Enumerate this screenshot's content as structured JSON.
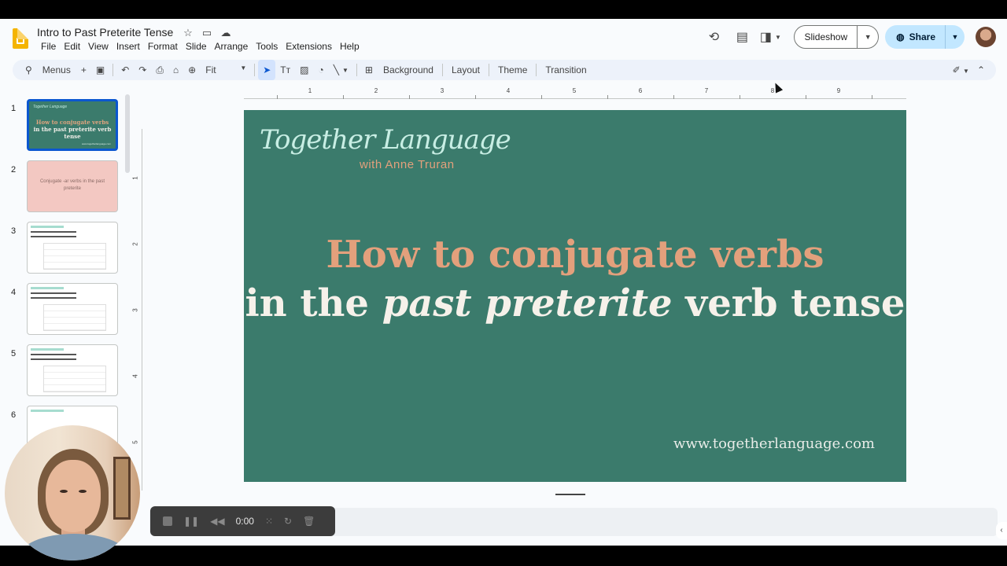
{
  "app": {
    "title": "Intro to Past Preterite Tense",
    "menu": [
      "File",
      "Edit",
      "View",
      "Insert",
      "Format",
      "Slide",
      "Arrange",
      "Tools",
      "Extensions",
      "Help"
    ]
  },
  "header": {
    "slideshow_label": "Slideshow",
    "share_label": "Share"
  },
  "toolbar": {
    "menus_label": "Menus",
    "zoom_label": "Fit",
    "background_label": "Background",
    "layout_label": "Layout",
    "theme_label": "Theme",
    "transition_label": "Transition"
  },
  "ruler": {
    "h_numbers": [
      "1",
      "2",
      "3",
      "4",
      "5",
      "6",
      "7",
      "8",
      "9"
    ],
    "v_numbers": [
      "1",
      "2",
      "3",
      "4",
      "5"
    ]
  },
  "filmstrip": {
    "slides": [
      {
        "num": "1",
        "kind": "title",
        "brand": "Together Language",
        "line1": "How to conjugate verbs",
        "line2": "in the past preterite verb tense",
        "url": "www.togetherlanguage.com"
      },
      {
        "num": "2",
        "kind": "pink",
        "text": "Conjugate -ar verbs in the past preterite"
      },
      {
        "num": "3",
        "kind": "table"
      },
      {
        "num": "4",
        "kind": "table"
      },
      {
        "num": "5",
        "kind": "table"
      },
      {
        "num": "6",
        "kind": "table"
      }
    ]
  },
  "slide": {
    "brand": "Together Language",
    "brand_sub": "with Anne Truran",
    "line1": "How to conjugate verbs",
    "line2_a": "in the ",
    "line2_em": "past preterite",
    "line2_b": " verb tense",
    "url": "www.togetherlanguage.com",
    "background_color": "#3b7b6c",
    "accent_color": "#e3a07c"
  },
  "recorder": {
    "time": "0:00"
  }
}
